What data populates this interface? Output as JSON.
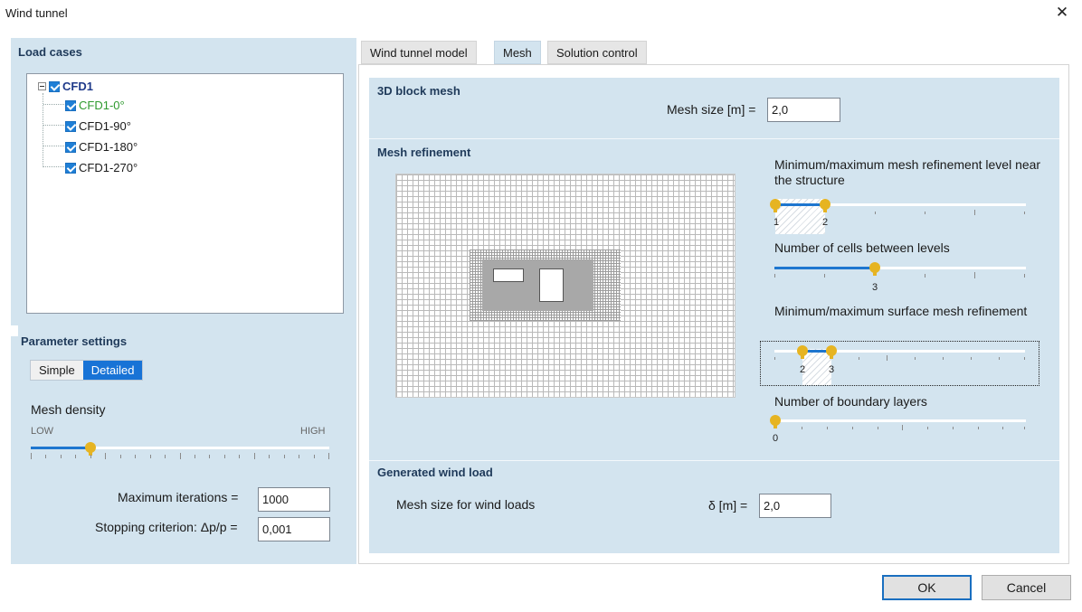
{
  "window": {
    "title": "Wind tunnel"
  },
  "left": {
    "load_cases_title": "Load cases",
    "tree": {
      "root": "CFD1",
      "children": [
        "CFD1-0°",
        "CFD1-90°",
        "CFD1-180°",
        "CFD1-270°"
      ]
    },
    "parameter_settings_title": "Parameter settings",
    "mode": {
      "simple": "Simple",
      "detailed": "Detailed",
      "selected": "Detailed"
    },
    "mesh_density": {
      "label": "Mesh density",
      "low": "LOW",
      "high": "HIGH",
      "level_fraction": 0.2
    },
    "max_iterations": {
      "label": "Maximum iterations =",
      "value": "1000"
    },
    "stopping": {
      "label": "Stopping criterion: Δp/p =",
      "value": "0,001"
    }
  },
  "tabs": [
    {
      "label": "Wind tunnel model",
      "active": false
    },
    {
      "label": "Mesh",
      "active": true
    },
    {
      "label": "Solution control",
      "active": false
    }
  ],
  "mesh_tab": {
    "block_mesh": {
      "title": "3D block mesh",
      "label": "Mesh size [m] =",
      "value": "2,0"
    },
    "refinement": {
      "title": "Mesh refinement",
      "near_structure": {
        "label": "Minimum/maximum mesh refinement level near the structure",
        "min": "1",
        "max": "2"
      },
      "cells_between": {
        "label": "Number of cells between levels",
        "value": "3"
      },
      "surface": {
        "label": "Minimum/maximum surface mesh refinement",
        "min": "2",
        "max": "3"
      },
      "boundary_layers": {
        "label": "Number of boundary layers",
        "value": "0"
      }
    },
    "wind_load": {
      "title": "Generated wind load",
      "label": "Mesh size for wind loads",
      "delta_label": "δ [m] =",
      "value": "2,0"
    }
  },
  "buttons": {
    "ok": "OK",
    "cancel": "Cancel"
  },
  "colors": {
    "accent": "#1873d6",
    "panel": "#d3e4ef",
    "thumb": "#e6b422",
    "tree_green": "#2e9a2e"
  }
}
